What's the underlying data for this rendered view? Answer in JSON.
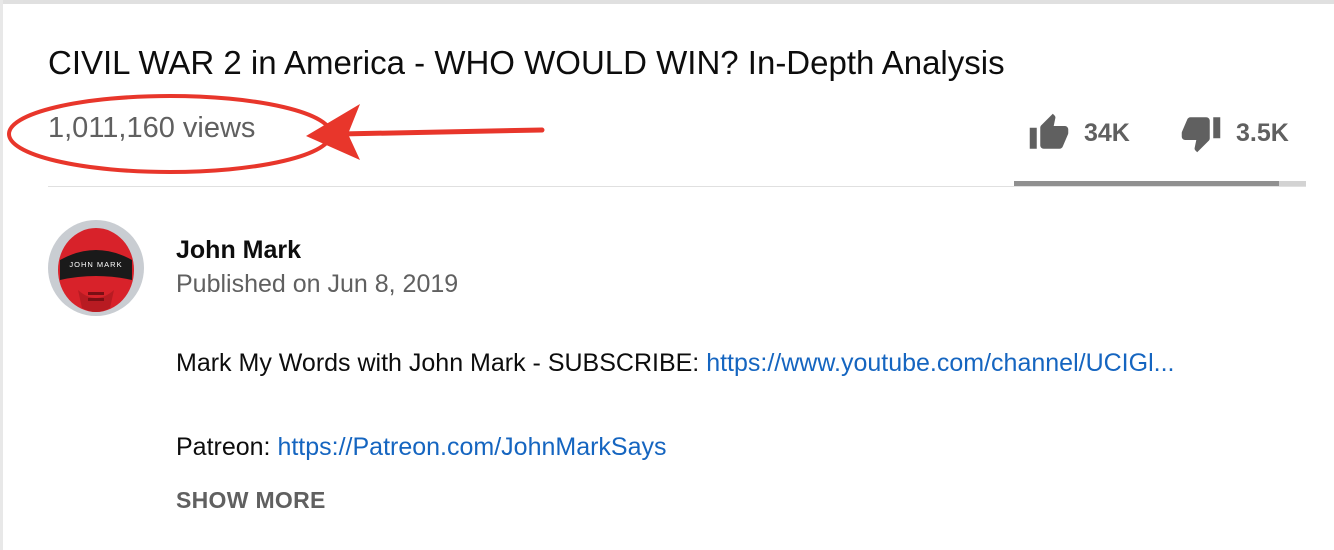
{
  "video": {
    "title": "CIVIL WAR 2 in America - WHO WOULD WIN? In-Depth Analysis",
    "views": "1,011,160 views"
  },
  "actions": {
    "like_icon": "thumb-up-icon",
    "like_count": "34K",
    "dislike_icon": "thumb-down-icon",
    "dislike_count": "3.5K",
    "like_ratio": 0.906
  },
  "channel": {
    "name": "John Mark",
    "avatar_text": "JOHN MARK",
    "published": "Published on Jun 8, 2019"
  },
  "description": {
    "line1_text": "Mark My Words with John Mark - SUBSCRIBE: ",
    "line1_link": "https://www.youtube.com/channel/UCIGl...",
    "line2_text": "Patreon: ",
    "line2_link": "https://Patreon.com/JohnMarkSays"
  },
  "show_more": "SHOW MORE",
  "colors": {
    "annotation": "#e8362b",
    "link": "#1565c0",
    "secondary_text": "#606060"
  }
}
